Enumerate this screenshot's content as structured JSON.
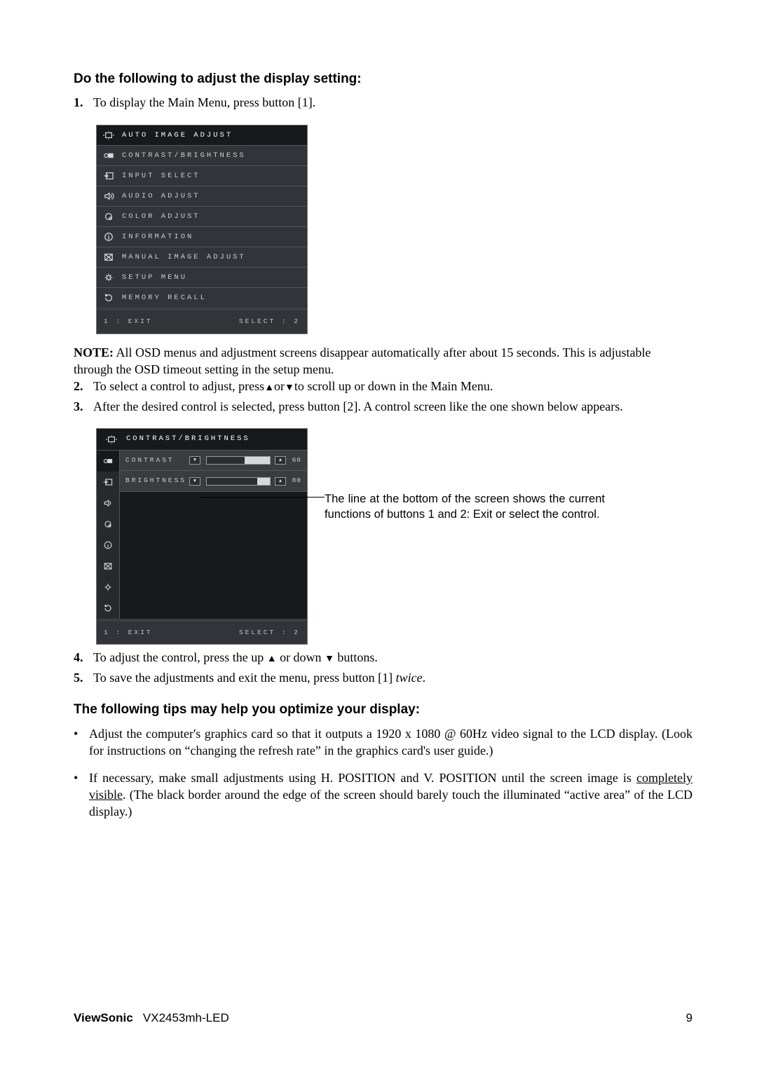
{
  "heading_main": "Do the following to adjust the display setting:",
  "steps": {
    "s1_num": "1.",
    "s1_text": "To display the Main Menu, press button [1].",
    "s2_num": "2.",
    "s2_text_a": "To select a control to adjust, press",
    "s2_text_b": "or",
    "s2_text_c": "to scroll up or down in the Main Menu.",
    "s3_num": "3.",
    "s3_text": "After the desired control is selected, press button [2]. A control screen like the one shown below appears.",
    "s4_num": "4.",
    "s4_text_a": "To adjust the control, press the up ",
    "s4_text_b": " or down ",
    "s4_text_c": " buttons.",
    "s5_num": "5.",
    "s5_text_a": "To save the adjustments and exit the menu, press button [1] ",
    "s5_text_b": "twice",
    "s5_text_c": "."
  },
  "note_label": "NOTE:",
  "note_text": " All OSD menus and adjustment screens disappear automatically after about 15 seconds. This is adjustable through the OSD timeout setting in the setup menu.",
  "osd": {
    "items": [
      "AUTO IMAGE ADJUST",
      "CONTRAST/BRIGHTNESS",
      "INPUT SELECT",
      "AUDIO ADJUST",
      "COLOR ADJUST",
      "INFORMATION",
      "MANUAL IMAGE ADJUST",
      "SETUP MENU",
      "MEMORY RECALL"
    ],
    "footer_left": "1 : EXIT",
    "footer_right": "SELECT : 2"
  },
  "osd2": {
    "title": "CONTRAST/BRIGHTNESS",
    "rows": [
      {
        "label": "CONTRAST",
        "value": "60",
        "fillPct": 40
      },
      {
        "label": "BRIGHTNESS",
        "value": "80",
        "fillPct": 20
      }
    ],
    "footer_left": "1 : EXIT",
    "footer_right": "SELECT : 2"
  },
  "callout": "The line at the bottom of the screen shows the current functions of buttons 1 and 2: Exit or select the control.",
  "tips_heading": "The following tips may help you optimize your display:",
  "tips": {
    "t1": "Adjust the computer's graphics card so that it outputs a 1920 x 1080 @ 60Hz video signal to the LCD display. (Look for instructions on “changing the refresh rate” in the graphics card's user guide.)",
    "t2a": "If necessary, make small adjustments using H. POSITION and V. POSITION until the screen image is ",
    "t2b": "completely visible",
    "t2c": ". (The black border around the edge of the screen should barely touch the illuminated “active area” of the LCD display.)"
  },
  "footer": {
    "brand": "ViewSonic",
    "model": "VX2453mh-LED",
    "page": "9"
  }
}
